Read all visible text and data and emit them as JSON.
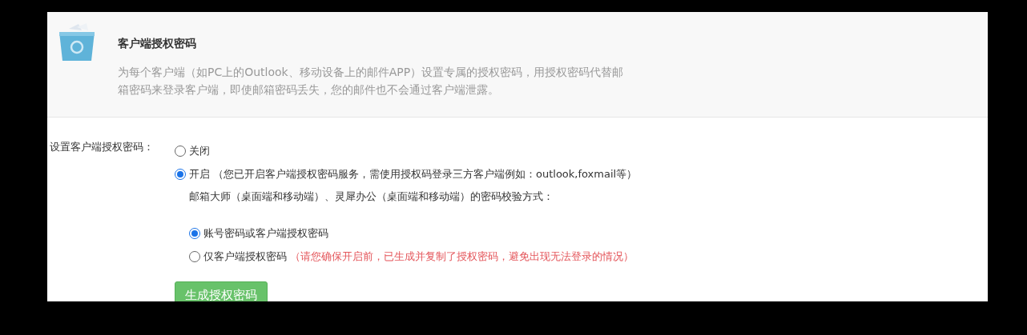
{
  "header": {
    "title": "客户端授权密码",
    "description": "为每个客户端（如PC上的Outlook、移动设备上的邮件APP）设置专属的授权密码，用授权密码代替邮箱密码来登录客户端，即使邮箱密码丢失，您的邮件也不会通过客户端泄露。"
  },
  "setting": {
    "label": "设置客户端授权密码：",
    "options": [
      {
        "label": "关闭",
        "selected": false
      },
      {
        "label": "开启",
        "note": "（您已开启客户端授权密码服务，需使用授权码登录三方客户端例如：outlook,foxmail等）",
        "selected": true
      }
    ],
    "verify_label": "邮箱大师（桌面端和移动端）、灵犀办公（桌面端和移动端）的密码校验方式：",
    "verify_options": [
      {
        "label": "账号密码或客户端授权密码",
        "selected": true
      },
      {
        "label": "仅客户端授权密码",
        "warning": "（请您确保开启前，已生成并复制了授权密码，避免出现无法登录的情况）",
        "selected": false
      }
    ]
  },
  "button": "生成授权密码"
}
